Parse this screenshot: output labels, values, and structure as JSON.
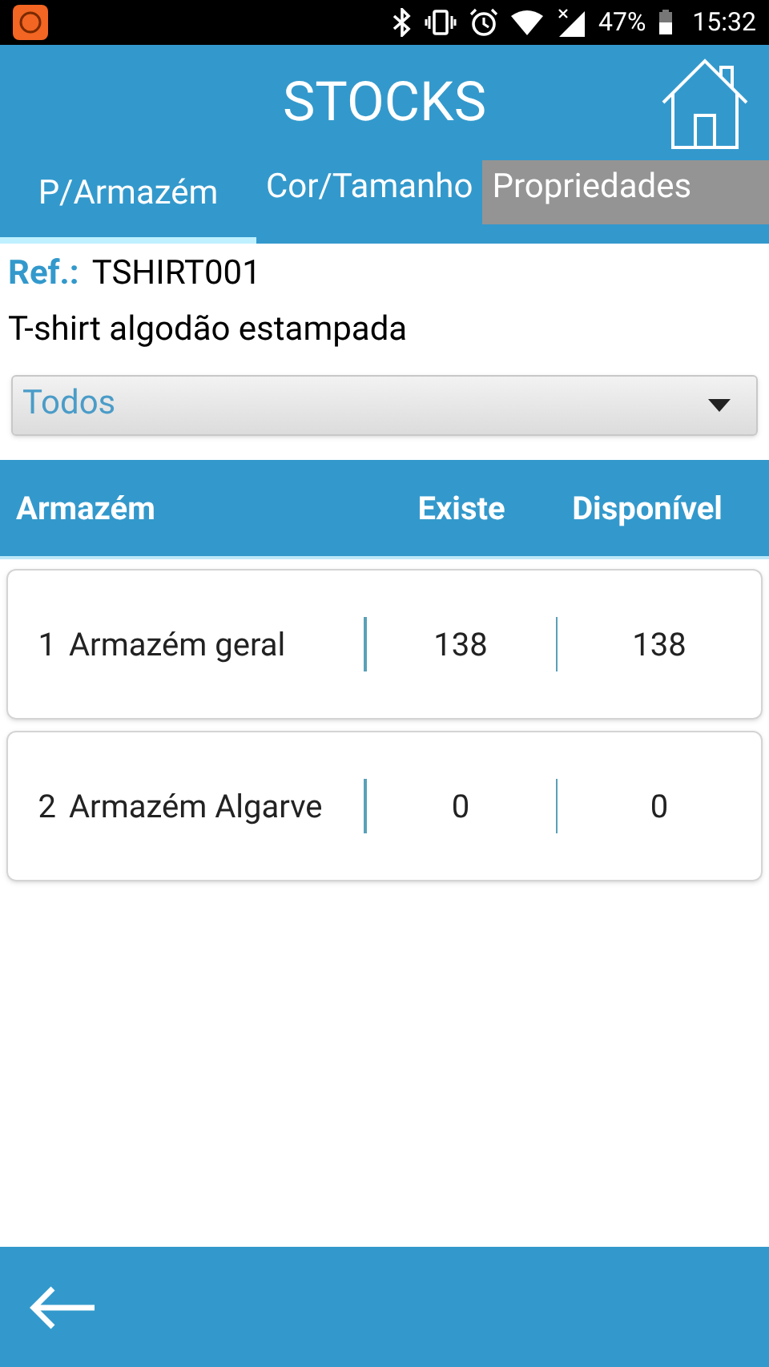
{
  "status_bar": {
    "battery": "47%",
    "time": "15:32"
  },
  "header": {
    "title": "STOCKS"
  },
  "tabs": [
    {
      "label": "P/Armazém",
      "selected": true,
      "disabled": false
    },
    {
      "label": "Cor/Tamanho",
      "selected": false,
      "disabled": false
    },
    {
      "label": "Propriedades",
      "selected": false,
      "disabled": true
    }
  ],
  "product": {
    "ref_label": "Ref.:",
    "ref": "TSHIRT001",
    "description": "T-shirt algodão estampada"
  },
  "filter": {
    "value": "Todos"
  },
  "table": {
    "columns": [
      "Armazém",
      "Existe",
      "Disponível"
    ],
    "rows": [
      {
        "number": "1",
        "name": "Armazém geral",
        "existe": "138",
        "disponivel": "138"
      },
      {
        "number": "2",
        "name": "Armazém Algarve",
        "existe": "0",
        "disponivel": "0"
      }
    ]
  }
}
